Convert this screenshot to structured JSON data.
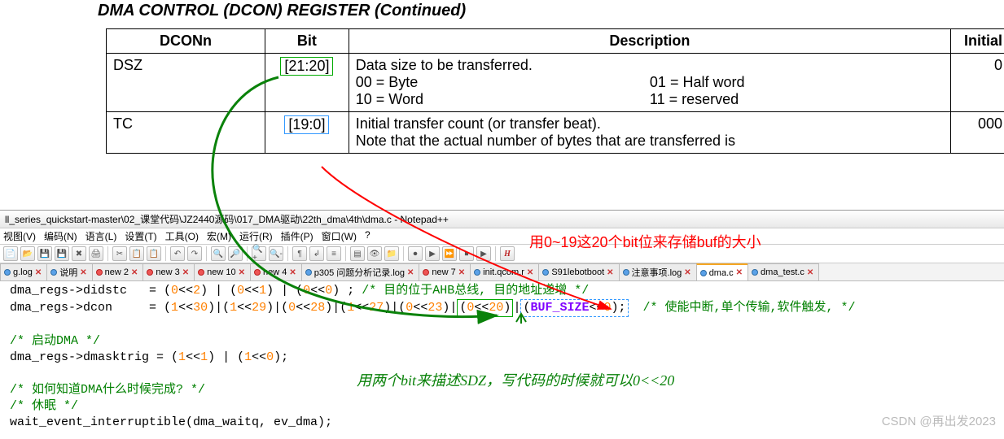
{
  "doc": {
    "title": "DMA CONTROL (DCON) REGISTER (Continued)",
    "headers": {
      "name": "DCONn",
      "bit": "Bit",
      "desc": "Description",
      "initial": "Initial"
    },
    "rows": [
      {
        "name": "DSZ",
        "bit": "[21:20]",
        "desc_line1": "Data size to be transferred.",
        "desc_00": "00 = Byte",
        "desc_01": "01 = Half word",
        "desc_10": "10 = Word",
        "desc_11": "11 = reserved",
        "initial": "0"
      },
      {
        "name": "TC",
        "bit": "[19:0]",
        "desc_line1": "Initial transfer count (or transfer beat).",
        "desc_line2": "Note that the actual number of bytes that are transferred is",
        "initial": "000"
      }
    ]
  },
  "npp": {
    "title": "ll_series_quickstart-master\\02_课堂代码\\JZ2440源码\\017_DMA驱动\\22th_dma\\4th\\dma.c - Notepad++",
    "menu": [
      "视图(V)",
      "编码(N)",
      "语言(L)",
      "设置(T)",
      "工具(O)",
      "宏(M)",
      "运行(R)",
      "插件(P)",
      "窗口(W)",
      "?"
    ],
    "tabs": [
      {
        "label": "g.log",
        "dirty": false
      },
      {
        "label": "说明",
        "dirty": false
      },
      {
        "label": "new 2",
        "dirty": true
      },
      {
        "label": "new 3",
        "dirty": true
      },
      {
        "label": "new 10",
        "dirty": true
      },
      {
        "label": "new 4",
        "dirty": true
      },
      {
        "label": "p305 问题分析记录.log",
        "dirty": false
      },
      {
        "label": "new 7",
        "dirty": true
      },
      {
        "label": "init.qcom.r",
        "dirty": false
      },
      {
        "label": "S91lebotboot",
        "dirty": false
      },
      {
        "label": "注意事项.log",
        "dirty": false
      },
      {
        "label": "dma.c",
        "dirty": false,
        "active": true
      },
      {
        "label": "dma_test.c",
        "dirty": false
      }
    ],
    "code": {
      "line1": {
        "pre": "dma_regs->didstc   = (",
        "n1": "0",
        "op1": "<<",
        "n2": "2",
        "mid1": ") | (",
        "n3": "0",
        "op2": "<<",
        "n4": "1",
        "mid2": ") | (",
        "n5": "0",
        "op3": "<<",
        "n6": "0",
        "post": ") ;",
        "cmt": "/* 目的位于AHB总线, 目的地址递增 */"
      },
      "line2": {
        "pre": "dma_regs->dcon     = (",
        "parts": [
          {
            "a": "1",
            "b": "30"
          },
          {
            "a": "1",
            "b": "29"
          },
          {
            "a": "0",
            "b": "28"
          },
          {
            "a": "1",
            "b": "27"
          },
          {
            "a": "0",
            "b": "23"
          }
        ],
        "green_a": "0",
        "green_b": "20",
        "buf": "BUF_SIZE",
        "bufshift": "0",
        "cmt": "/* 使能中断,单个传输,软件触发, */"
      },
      "line3_cmt": "/* 启动DMA */",
      "line4": {
        "pre": "dma_regs->dmasktrig = (",
        "a": "1",
        "b": "1",
        "c": "1",
        "d": "0",
        "post": ");"
      },
      "line5_cmt": "/* 如何知道DMA什么时候完成? */",
      "line6_cmt": "/* 休眠 */",
      "line7": "wait_event_interruptible(dma_waitq, ev_dma);"
    }
  },
  "annotations": {
    "red": "用0~19这20个bit位来存储buf的大小",
    "green": "用两个bit来描述SDZ，写代码的时候就可以0<<20"
  },
  "watermark": "CSDN @再出发2023"
}
